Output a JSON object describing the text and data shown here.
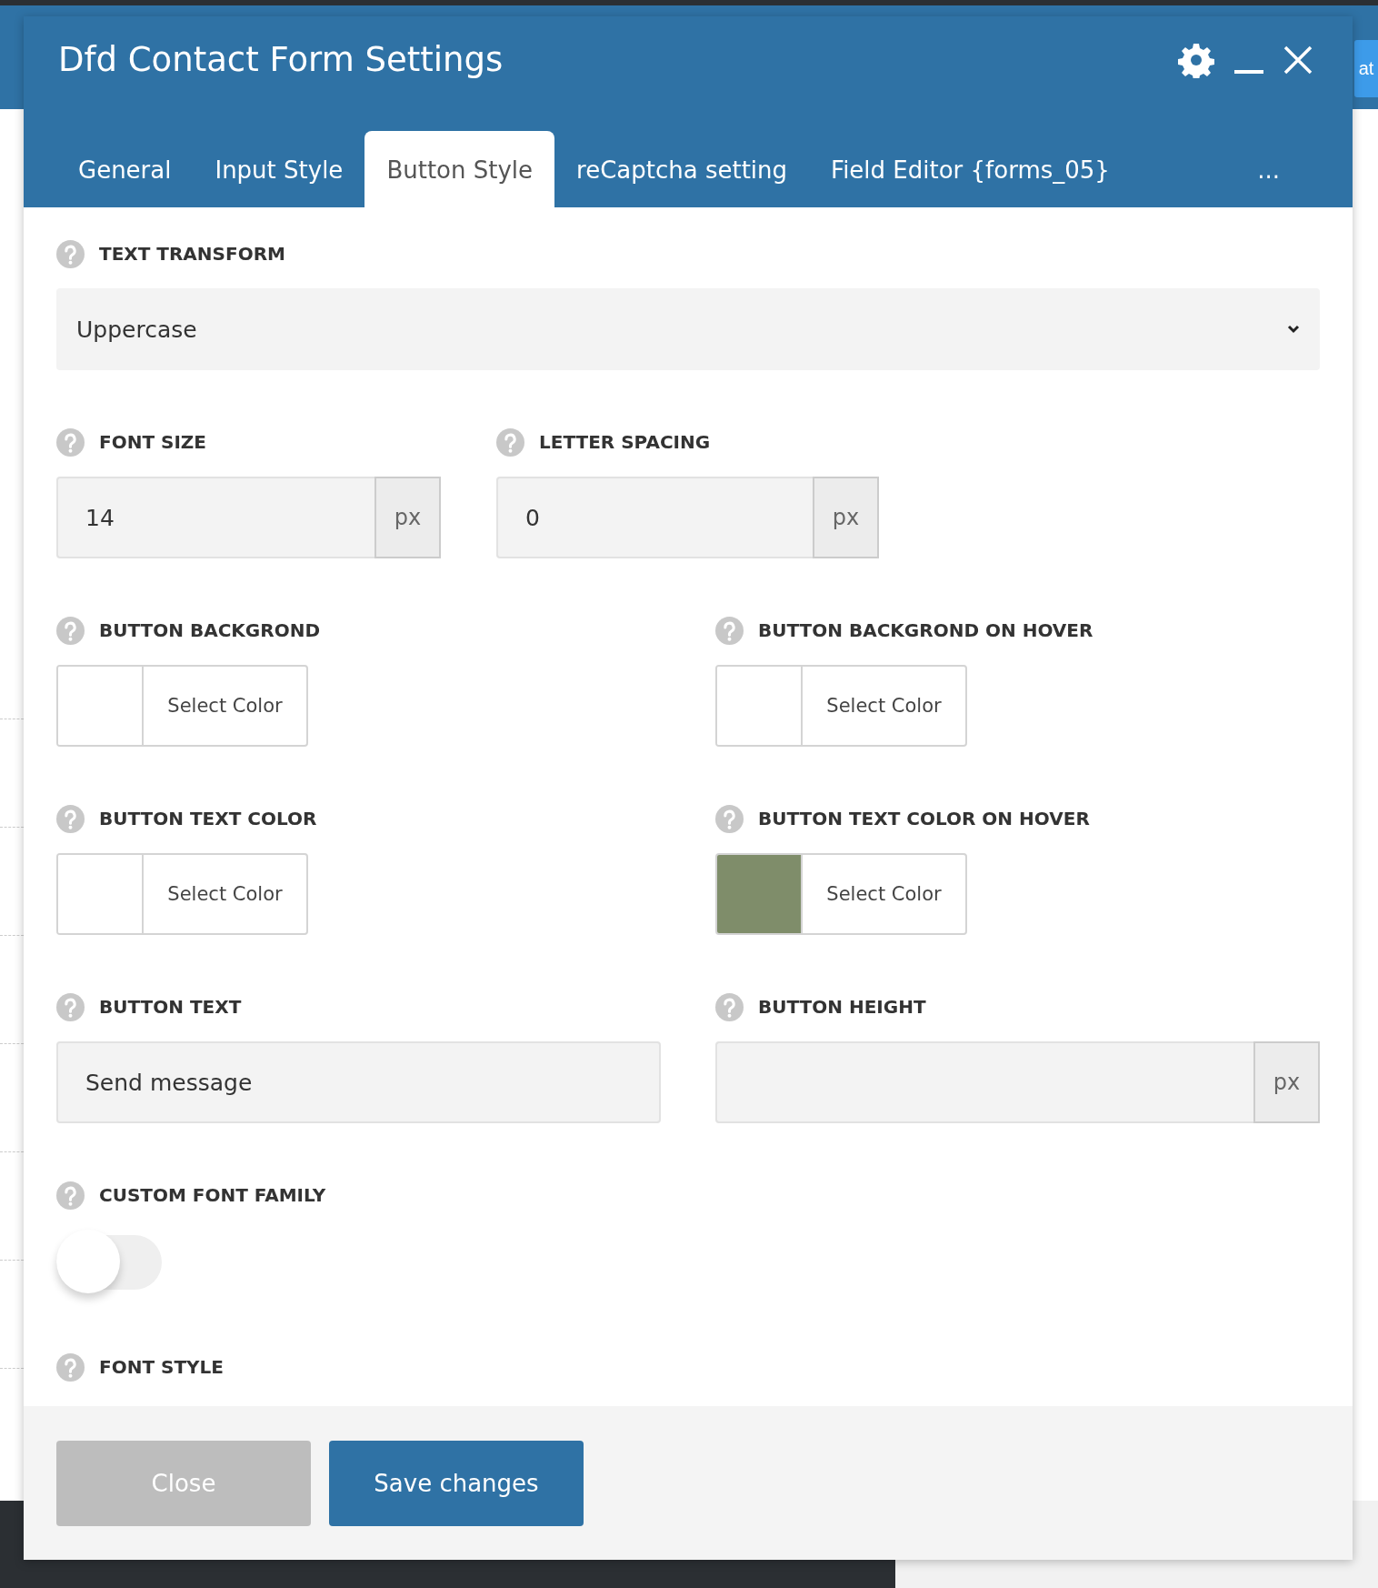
{
  "background": {
    "button": "at"
  },
  "dialog": {
    "title": "Dfd Contact Form Settings",
    "tabs": [
      {
        "label": "General",
        "selected": false
      },
      {
        "label": "Input Style",
        "selected": false
      },
      {
        "label": "Button Style",
        "selected": true
      },
      {
        "label": "reCaptcha setting",
        "selected": false
      },
      {
        "label": "Field Editor {forms_05}",
        "selected": false
      }
    ],
    "more": "...",
    "rows": [
      {
        "kind": "full",
        "fields": [
          {
            "kind": "select",
            "label": "TEXT TRANSFORM",
            "value": "Uppercase"
          }
        ]
      },
      {
        "kind": "compact",
        "fields": [
          {
            "kind": "unit",
            "label": "FONT SIZE",
            "value": "14",
            "unit": "px"
          },
          {
            "kind": "unit",
            "label": "LETTER SPACING",
            "value": "0",
            "unit": "px"
          }
        ]
      },
      {
        "kind": "half",
        "fields": [
          {
            "kind": "color",
            "label": "BUTTON BACKGROND",
            "color": "#ffffff",
            "button": "Select Color"
          },
          {
            "kind": "color",
            "label": "BUTTON BACKGROND ON HOVER",
            "color": "#ffffff",
            "button": "Select Color"
          }
        ]
      },
      {
        "kind": "half",
        "fields": [
          {
            "kind": "color",
            "label": "BUTTON TEXT COLOR",
            "color": "#ffffff",
            "button": "Select Color"
          },
          {
            "kind": "color",
            "label": "BUTTON TEXT COLOR ON HOVER",
            "color": "#7f8d6a",
            "button": "Select Color"
          }
        ]
      },
      {
        "kind": "half",
        "fields": [
          {
            "kind": "text",
            "label": "BUTTON TEXT",
            "value": "Send message"
          },
          {
            "kind": "unit",
            "label": "BUTTON HEIGHT",
            "unit": "px"
          }
        ]
      },
      {
        "kind": "full",
        "fields": [
          {
            "kind": "toggle",
            "label": "CUSTOM FONT FAMILY",
            "on": false
          }
        ]
      },
      {
        "kind": "full",
        "fields": [
          {
            "kind": "heading",
            "label": "FONT STYLE"
          }
        ]
      }
    ],
    "buttons": [
      {
        "label": "Close",
        "kind": "secondary"
      },
      {
        "label": "Save changes",
        "kind": "primary"
      }
    ]
  }
}
